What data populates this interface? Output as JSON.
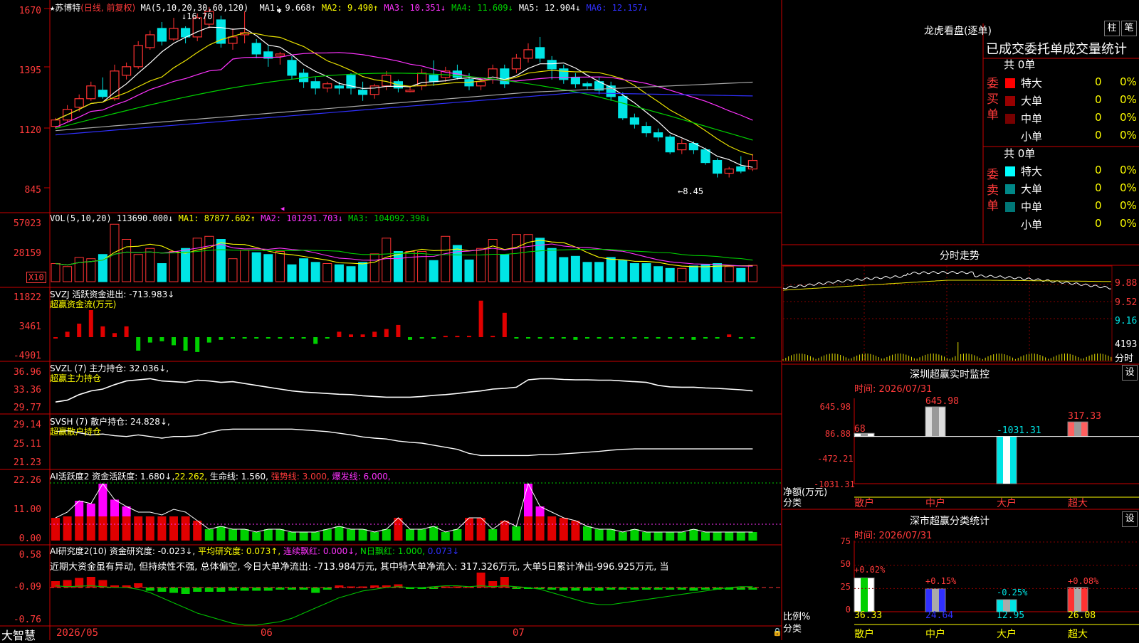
{
  "colors": {
    "up": "#ff3232",
    "down": "#00e5e5",
    "ma1": "#ffffff",
    "ma2": "#e8e000",
    "ma3": "#ff33ff",
    "ma4": "#00c800",
    "ma5": "#aaaaaa",
    "ma6": "#3030ff",
    "flow_pos": "#e00000",
    "flow_neg": "#00d000",
    "hold": "#ffffff",
    "yellow": "#ffff00",
    "axis": "#ff3a3a"
  },
  "icons": {
    "star": "star-icon",
    "marker": "marker-icon"
  },
  "main": {
    "title_star": "★",
    "stock_name": "苏博特",
    "period": "(日线, 前复权)",
    "ma_params": "MA(5,10,20,30,60,120)",
    "ma": [
      {
        "label": "MA1: 9.668↑",
        "color": "#ffffff"
      },
      {
        "label": "MA2: 9.490↑",
        "color": "#ffff00"
      },
      {
        "label": "MA3: 10.351↓",
        "color": "#ff33ff"
      },
      {
        "label": "MA4: 11.609↓",
        "color": "#00d000"
      },
      {
        "label": "MA5: 12.904↓",
        "color": "#ffffff"
      },
      {
        "label": "MA6: 12.157↓",
        "color": "#3030ff"
      }
    ],
    "high_marker": "16.70",
    "low_marker": "←8.45",
    "yticks": [
      "1670",
      "1395",
      "1120",
      "845"
    ]
  },
  "vol": {
    "header": "VOL(5,10,20) 113690.000↓",
    "ma1": "MA1: 87877.602↑",
    "ma2": "MA2: 101291.703↓",
    "ma3": "MA3: 104092.398↓",
    "yticks": [
      "57023",
      "28159"
    ],
    "unit": "X10"
  },
  "svzj": {
    "header": "SVZJ  活跃资金进出: -713.983↓",
    "sub": "超赢资金流(万元)",
    "yticks": [
      "11822",
      "3461",
      "-4901"
    ]
  },
  "svzl": {
    "header": "SVZL (7) 主力持仓: 32.036↓,",
    "sub": "超赢主力持仓",
    "yticks": [
      "36.96",
      "33.36",
      "29.77"
    ]
  },
  "svsh": {
    "header": "SVSH (7) 散户持仓: 24.828↓,",
    "sub": "超赢散户持仓",
    "yticks": [
      "29.14",
      "25.11",
      "21.23"
    ]
  },
  "ai1": {
    "header": "AI活跃度2 资金活跃度: 1.680↓,",
    "v2": "22.262,",
    "life": "生命线: 1.560,",
    "strong": "强势线: 3.000,",
    "burst": "爆发线: 6.000,",
    "yticks": [
      "22.26",
      "11.00",
      "0.00"
    ]
  },
  "ai2": {
    "header": "AI研究度2(10) 资金研究度: -0.023↓,",
    "avg": "平均研究度: 0.073↑,",
    "cont": "连续飘红: 0.000↓,",
    "nday": "N日飘红: 1.000,",
    "last": "0.073↓",
    "comment": "近期大资金虽有异动, 但持续性不强, 总体偏空, 今日大单净流出: -713.984万元, 其中特大单净流入: 317.326万元, 大单5日累计净出-996.925万元, 当",
    "yticks": [
      "0.58",
      "-0.09",
      "-0.76"
    ]
  },
  "xaxis": {
    "brand": "大智慧",
    "labels": [
      "2026/05",
      "06",
      "07"
    ]
  },
  "longhu": {
    "title": "龙虎看盘(逐单)",
    "btn1": "柱",
    "btn2": "笔",
    "subtitle": "已成交委托单成交量统计",
    "buy_label": "委买单",
    "sell_label": "委卖单",
    "buy_total": "共 0单",
    "sell_total": "共 0单",
    "buy_rows": [
      {
        "name": "特大",
        "count": "0",
        "pct": "0%",
        "color": "#ff0000"
      },
      {
        "name": "大单",
        "count": "0",
        "pct": "0%",
        "color": "#990000"
      },
      {
        "name": "中单",
        "count": "0",
        "pct": "0%",
        "color": "#770000"
      },
      {
        "name": "小单",
        "count": "0",
        "pct": "0%",
        "color": ""
      }
    ],
    "sell_rows": [
      {
        "name": "特大",
        "count": "0",
        "pct": "0%",
        "color": "#00ffff"
      },
      {
        "name": "大单",
        "count": "0",
        "pct": "0%",
        "color": "#008888"
      },
      {
        "name": "中单",
        "count": "0",
        "pct": "0%",
        "color": "#007777"
      },
      {
        "name": "小单",
        "count": "0",
        "pct": "0%",
        "color": ""
      }
    ]
  },
  "intraday": {
    "title": "分时走势",
    "yticks": [
      "9.88",
      "9.52",
      "9.16"
    ],
    "vol_label": "4193",
    "unit_label": "分时"
  },
  "monitor": {
    "title": "深圳超赢实时监控",
    "btn": "设",
    "time": "时间: 2026/07/31",
    "yticks": [
      "645.98",
      "86.88",
      "-472.21",
      "-1031.31"
    ],
    "ylabel1": "净额(万元)",
    "ylabel2": "分类",
    "categories": [
      "散户",
      "中户",
      "大户",
      "超大"
    ],
    "values": [
      68,
      645.98,
      -1031.31,
      317.33
    ],
    "value_labels": [
      "68",
      "645.98",
      "-1031.31",
      "317.33"
    ]
  },
  "stats": {
    "title": "深市超赢分类统计",
    "btn": "设",
    "time": "时间: 2026/07/31",
    "yticks": [
      "75",
      "50",
      "25",
      "0"
    ],
    "ylabel1": "比例%",
    "ylabel2": "分类",
    "categories": [
      "散户",
      "中户",
      "大户",
      "超大"
    ],
    "values": [
      36.33,
      24.64,
      12.95,
      26.08
    ],
    "value_labels": [
      "36.33",
      "24.64",
      "12.95",
      "26.08"
    ],
    "changes": [
      "+0.02%",
      "+0.15%",
      "-0.25%",
      "+0.08%"
    ]
  }
}
